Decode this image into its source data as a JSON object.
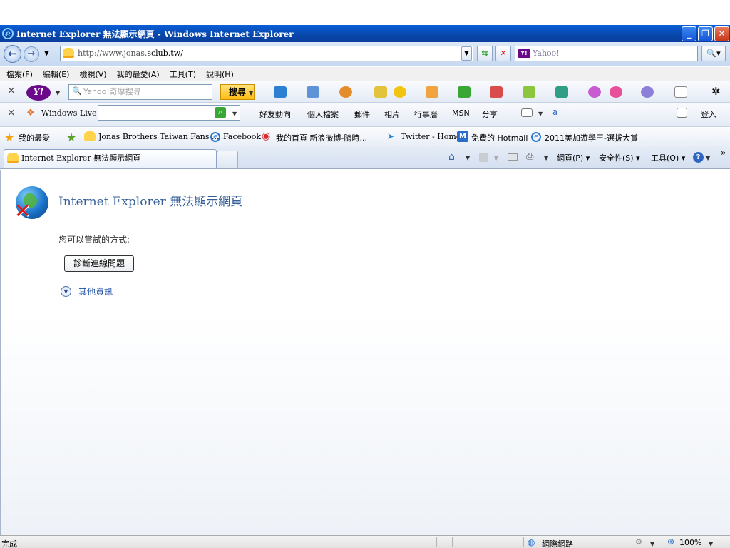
{
  "window": {
    "title": "Internet Explorer 無法顯示網頁 - Windows Internet Explorer"
  },
  "address_bar": {
    "url_prefix": "http://www.jonas.",
    "url_host": "sclub.tw/",
    "search_placeholder": "Yahoo!"
  },
  "menu": {
    "items": [
      "檔案(F)",
      "編輯(E)",
      "檢視(V)",
      "我的最愛(A)",
      "工具(T)",
      "說明(H)"
    ]
  },
  "yahoo_toolbar": {
    "search_placeholder": "Yahoo!奇摩搜尋",
    "search_button": "搜尋"
  },
  "live_toolbar": {
    "brand": "Windows Live",
    "links": [
      "好友動向",
      "個人檔案",
      "郵件",
      "相片",
      "行事曆",
      "MSN",
      "分享"
    ],
    "signin": "登入"
  },
  "favorites_bar": {
    "label": "我的最愛",
    "items": [
      "Jonas Brothers Taiwan Fans ...",
      "Facebook",
      "我的首頁 新浪微博-隨時...",
      "Twitter - Home",
      "免費的 Hotmail",
      "2011美加遊學王-選拔大賞"
    ]
  },
  "tab": {
    "title": "Internet Explorer 無法顯示網頁"
  },
  "command_bar": {
    "page": "網頁(P)",
    "safety": "安全性(S)",
    "tools": "工具(O)"
  },
  "content": {
    "heading": "Internet Explorer 無法顯示網頁",
    "try_text": "您可以嘗試的方式:",
    "diagnose_button": "診斷連線問題",
    "more_info": "其他資訊"
  },
  "status_bar": {
    "status": "完成",
    "zone": "網際網路",
    "zoom": "100%"
  },
  "colors": {
    "titlebar": "#0a4fc0",
    "link": "#1e4fa6",
    "heading": "#355f99"
  }
}
